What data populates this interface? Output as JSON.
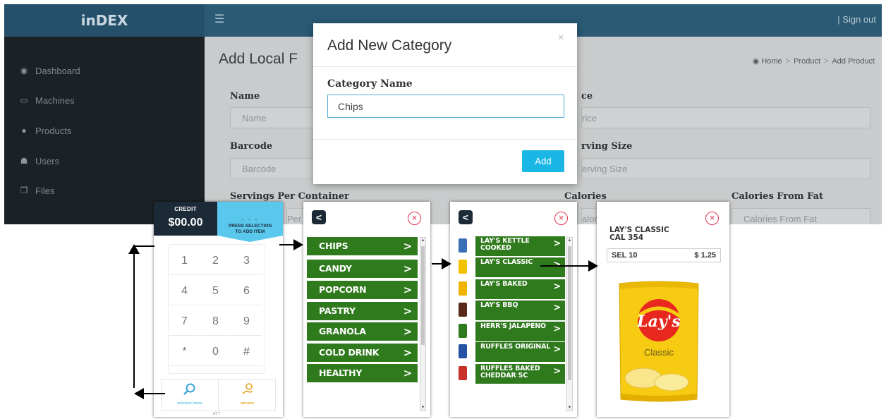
{
  "app": {
    "brand": "inDEX",
    "menu_icon": "hamburger-icon",
    "sign_out": "| Sign out",
    "page_title": "Add Local F",
    "breadcrumb": [
      "Home",
      "Product",
      "Add Product"
    ],
    "sidebar": [
      {
        "label": "Dashboard",
        "icon": "dashboard-icon"
      },
      {
        "label": "Machines",
        "icon": "laptop-icon"
      },
      {
        "label": "Products",
        "icon": "products-icon"
      },
      {
        "label": "Users",
        "icon": "users-icon"
      },
      {
        "label": "Files",
        "icon": "files-icon"
      }
    ],
    "form": {
      "name_label": "Name",
      "name_placeholder": "Name",
      "price_label": "ce",
      "price_placeholder": "rice",
      "barcode_label": "Barcode",
      "barcode_placeholder": "Barcode",
      "serving_size_label": "rving Size",
      "serving_size_placeholder": "erving Size",
      "servings_label": "Servings Per Container",
      "servings_placeholder": "Per",
      "calories_label": "Calories",
      "calories_placeholder": "alor",
      "calories_fat_label": "Calories From Fat",
      "calories_fat_placeholder": "Calories From Fat"
    },
    "modal": {
      "title": "Add New Category",
      "close": "×",
      "field_label": "Category Name",
      "field_value": "Chips",
      "add_button": "Add"
    }
  },
  "kiosk": {
    "keypad_screen": {
      "credit_label": "CREDIT",
      "credit_value": "$00.00",
      "selection_dashes": "- - -",
      "selection_hint_line1": "PRESS SELECTION",
      "selection_hint_line2": "TO ADD ITEM",
      "keys": [
        "1",
        "2",
        "3",
        "4",
        "5",
        "6",
        "7",
        "8",
        "9",
        "*",
        "0",
        "#"
      ],
      "browse_label": "BROWSE ITEMS",
      "return_label": "RETURN",
      "footer": "AT T"
    },
    "category_screen": {
      "categories": [
        "CHIPS",
        "CANDY",
        "POPCORN",
        "PASTRY",
        "GRANOLA",
        "COLD DRINK",
        "HEALTHY"
      ]
    },
    "product_screen": {
      "products": [
        {
          "line1": "LAY'S KETTLE",
          "line2": "COOKED",
          "color": "#3b6fb6"
        },
        {
          "line1": "LAY'S CLASSIC",
          "line2": "",
          "color": "#f2c200"
        },
        {
          "line1": "LAY'S BAKED",
          "line2": "",
          "color": "#f0b400"
        },
        {
          "line1": "LAY'S BBQ",
          "line2": "",
          "color": "#5a2a18"
        },
        {
          "line1": "HERR'S JALAPENO",
          "line2": "",
          "color": "#2f7a1d"
        },
        {
          "line1": "RUFFLES ORIGINAL",
          "line2": "",
          "color": "#2451a4"
        },
        {
          "line1": "RUFFLES BAKED",
          "line2": "CHEDDAR SC",
          "color": "#c8302a"
        }
      ]
    },
    "detail_screen": {
      "name_line1": "LAY'S CLASSIC",
      "name_line2": "CAL  354",
      "selection": "SEL 10",
      "price": "$ 1.25",
      "bag_brand": "Lay's",
      "bag_flavor": "Classic"
    }
  }
}
